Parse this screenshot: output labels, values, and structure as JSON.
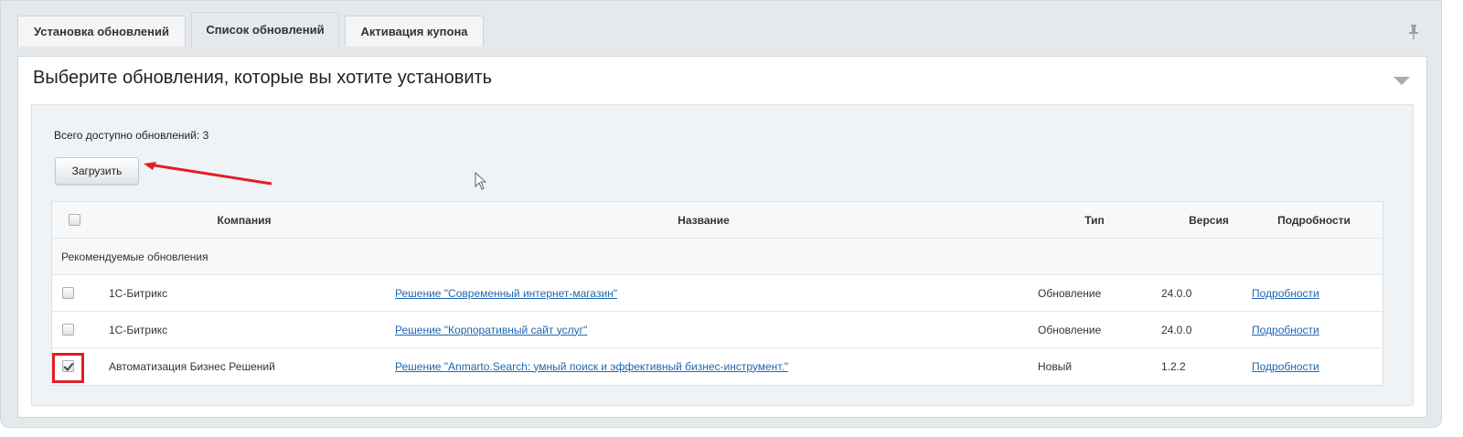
{
  "tabs": [
    {
      "label": "Установка обновлений"
    },
    {
      "label": "Список обновлений"
    },
    {
      "label": "Активация купона"
    }
  ],
  "panel": {
    "title": "Выберите обновления, которые вы хотите установить"
  },
  "summary": {
    "total_text": "Всего доступно обновлений: 3"
  },
  "buttons": {
    "load_label": "Загрузить"
  },
  "table": {
    "headers": {
      "company": "Компания",
      "name": "Название",
      "type": "Тип",
      "version": "Версия",
      "details": "Подробности"
    },
    "group_label": "Рекомендуемые обновления",
    "rows": [
      {
        "company": "1С-Битрикс",
        "name": "Решение \"Современный интернет-магазин\"",
        "type": "Обновление",
        "version": "24.0.0",
        "details": "Подробности",
        "checked": false
      },
      {
        "company": "1С-Битрикс",
        "name": "Решение \"Корпоративный сайт услуг\"",
        "type": "Обновление",
        "version": "24.0.0",
        "details": "Подробности",
        "checked": false
      },
      {
        "company": "Автоматизация Бизнес Решений",
        "name": "Решение \"Anmarto.Search: умный поиск и эффективный бизнес-инструмент.\"",
        "type": "Новый",
        "version": "1.2.2",
        "details": "Подробности",
        "checked": true
      }
    ]
  },
  "colors": {
    "annotation": "#e01f26",
    "link": "#2067b0"
  }
}
